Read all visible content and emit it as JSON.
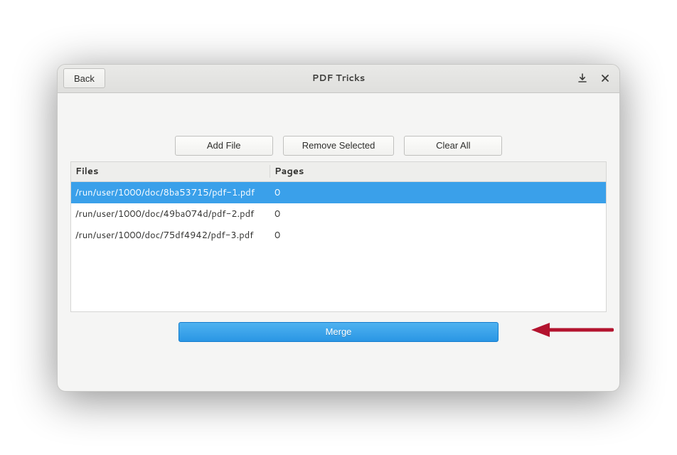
{
  "titlebar": {
    "back_label": "Back",
    "title": "PDF Tricks"
  },
  "toolbar": {
    "add_file_label": "Add File",
    "remove_selected_label": "Remove Selected",
    "clear_all_label": "Clear All"
  },
  "table": {
    "header_files": "Files",
    "header_pages": "Pages",
    "rows": [
      {
        "file": "/run/user/1000/doc/8ba53715/pdf-1.pdf",
        "pages": "0",
        "selected": true
      },
      {
        "file": "/run/user/1000/doc/49ba074d/pdf-2.pdf",
        "pages": "0",
        "selected": false
      },
      {
        "file": "/run/user/1000/doc/75df4942/pdf-3.pdf",
        "pages": "0",
        "selected": false
      }
    ]
  },
  "merge_label": "Merge",
  "accent_color": "#3aa0ea"
}
